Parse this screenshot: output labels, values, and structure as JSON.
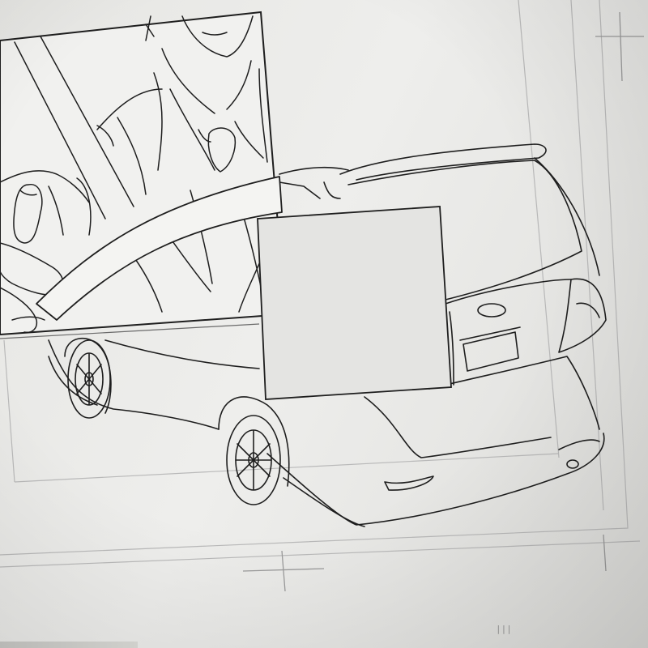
{
  "scene": {
    "description_kind": "photo of a monitor showing a comic illustration in a drawing application",
    "canvas_color": "#ededeb",
    "line_color": "#1e1e1e",
    "guide_color": "#b9b9b9"
  },
  "canvas": {
    "scrollbar_marker": "|||"
  },
  "icons": {
    "crop_mark_top_right": "crop-mark-icon",
    "crop_mark_bottom": "crop-mark-icon"
  }
}
